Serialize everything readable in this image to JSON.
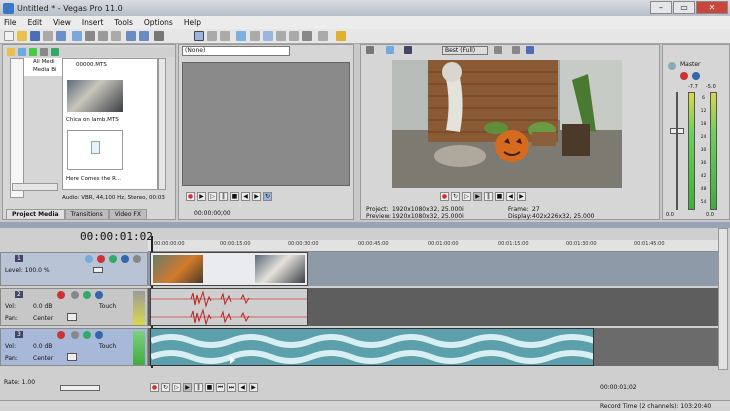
{
  "window": {
    "title": "Untitled * - Vegas Pro 11.0"
  },
  "menu": [
    "File",
    "Edit",
    "View",
    "Insert",
    "Tools",
    "Options",
    "Help"
  ],
  "explorer": {
    "tree": [
      "All Medi",
      "Media Bi"
    ],
    "clip_top_name": "00000.MTS",
    "clip1_name": "Chica on lamb.MTS",
    "clip2_name": "Here Comes the R...",
    "audio_info": "Audio: VBR, 44,100 Hz, Stereo, 00:03"
  },
  "tabs": [
    "Project Media",
    "Transitions",
    "Video FX"
  ],
  "trimmer": {
    "dropdown": "(None)",
    "time": "00:00:00;00"
  },
  "preview": {
    "quality": "Best (Full)",
    "project_label": "Project:",
    "project_value": "1920x1080x32, 25.000i",
    "preview_label": "Preview:",
    "preview_value": "1920x1080x32, 25.000i",
    "frame_label": "Frame:",
    "frame_value": "27",
    "display_label": "Display:",
    "display_value": "402x226x32, 25.000"
  },
  "mixer": {
    "title": "Master",
    "left_peak": "-7.7",
    "right_peak": "-5.0",
    "scale": [
      "6",
      "12",
      "18",
      "24",
      "30",
      "36",
      "42",
      "48",
      "54"
    ],
    "fader_values": [
      "0.0",
      "0.0"
    ]
  },
  "timeline": {
    "timecode": "00:00:01:02",
    "ruler_ticks": [
      "00:00:00:00",
      "00:00:15:00",
      "00:00:30:00",
      "00:00:45:00",
      "00:01:00:00",
      "00:01:15:00",
      "00:01:30:00",
      "00:01:45:00"
    ],
    "video_track": {
      "level_label": "Level: 100.0 %",
      "number": "1"
    },
    "audio_track1": {
      "number": "2",
      "vol_label": "Vol:",
      "vol_value": "0.0 dB",
      "pan_label": "Pan:",
      "pan_value": "Center",
      "touch": "Touch"
    },
    "audio_track2": {
      "number": "3",
      "vol_label": "Vol:",
      "vol_value": "0.0 dB",
      "pan_label": "Pan:",
      "pan_value": "Center",
      "touch": "Touch"
    },
    "rate_label": "Rate: 1.00",
    "bottom_time": "00:00:01;02",
    "record_time": "Record Time (2 channels): 103:20:40"
  }
}
